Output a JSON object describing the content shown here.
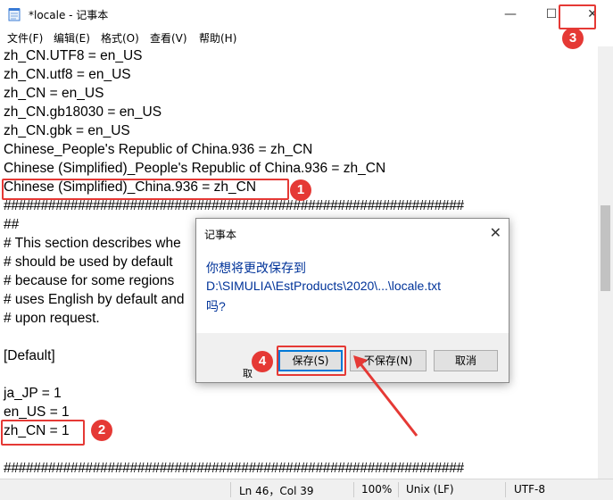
{
  "window": {
    "title": "*locale - 记事本",
    "minimize_glyph": "—",
    "maximize_glyph": "☐",
    "close_glyph": "✕"
  },
  "menu": [
    {
      "label": "文件(F)"
    },
    {
      "label": "编辑(E)"
    },
    {
      "label": "格式(O)"
    },
    {
      "label": "查看(V)"
    },
    {
      "label": "帮助(H)"
    }
  ],
  "editor": {
    "lines": [
      "zh_CN.UTF8 = en_US",
      "zh_CN.utf8 = en_US",
      "zh_CN = en_US",
      "zh_CN.gb18030 = en_US",
      "zh_CN.gbk = en_US",
      "Chinese_People's Republic of China.936 = zh_CN",
      "Chinese (Simplified)_People's Republic of China.936 = zh_CN",
      "Chinese (Simplified)_China.936 = zh_CN",
      "##############################################################",
      "##",
      "# This section describes whe",
      "# should be used by default",
      "# because for some regions",
      "# uses English by default and",
      "# upon request.",
      "",
      "[Default]",
      "",
      "ja_JP = 1",
      "en_US = 1",
      "zh_CN = 1",
      "",
      "##############################################################"
    ]
  },
  "status": {
    "position": "Ln 46，Col 39",
    "zoom": "100%",
    "line_ending": "Unix (LF)",
    "encoding": "UTF-8"
  },
  "dialog": {
    "title": "记事本",
    "close_glyph": "✕",
    "message_line1": "你想将更改保存到",
    "message_line2": "D:\\SIMULIA\\EstProducts\\2020\\...\\locale.txt",
    "message_line3": "吗?",
    "save_label": "保存(S)",
    "dont_save_label": "不保存(N)",
    "cancel_label": "取消"
  },
  "ghost_text": "取",
  "annotations": {
    "color": "#e53935",
    "step1": "1",
    "step2": "2",
    "step3": "3",
    "step4": "4"
  }
}
